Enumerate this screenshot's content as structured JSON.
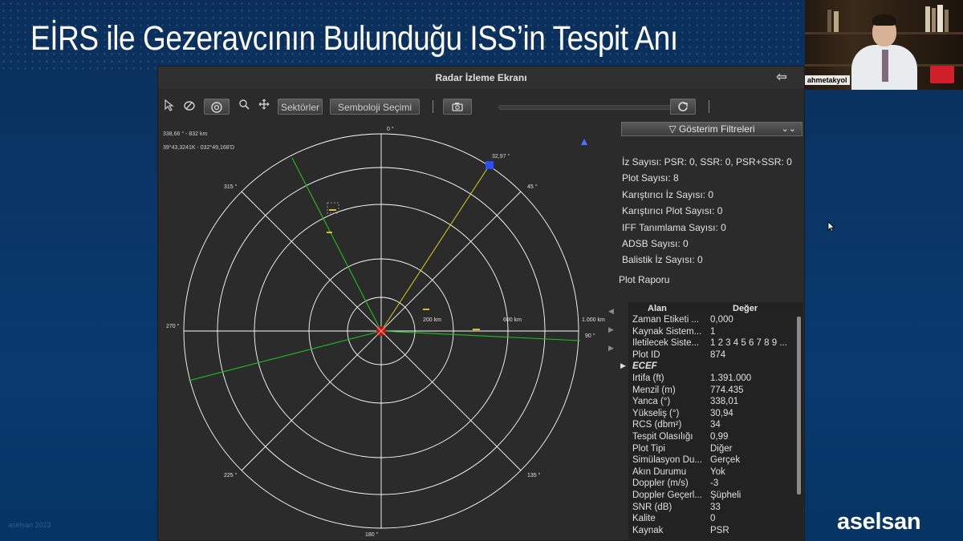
{
  "slide": {
    "title": "EİRS ile Gezeravcının Bulunduğu ISS’in Tespit Anı",
    "brand_logo": "aselsan",
    "watermark": "aselsan 2023"
  },
  "app": {
    "window_title": "Radar İzleme Ekranı",
    "toolbar": {
      "sectors_label": "Sektörler",
      "symbology_label": "Semboloji Seçimi"
    },
    "cursor_range": "338,66 ° - 832 km",
    "cursor_position": "39°43,3241K - 032°49,168'D"
  },
  "radar": {
    "bearing_labels": {
      "n": "0 °",
      "ne": "45 °",
      "e": "90 °",
      "se": "135 °",
      "s": "180 °",
      "sw": "225 °",
      "w": "270 °",
      "nw": "315 °"
    },
    "range_labels": {
      "r200": "200 km",
      "r600": "600 km",
      "r1000": "1.000 km"
    },
    "target_label": "32,97 °",
    "colors": {
      "background": "#2b2b2b",
      "rings": "#ffffff",
      "beam_green": "#20c020",
      "beam_yellow": "#d8d020",
      "target": "#2b4cff",
      "center": "#d01818"
    }
  },
  "filters": {
    "title": "Gösterim Filtreleri",
    "stats": [
      "İz Sayısı: PSR: 0, SSR: 0, PSR+SSR: 0",
      "Plot Sayısı: 8",
      "Karıştırıcı İz Sayısı: 0",
      "Karıştırıcı Plot Sayısı: 0",
      "IFF Tanımlama Sayısı: 0",
      "ADSB Sayısı: 0",
      "Balistik İz Sayısı: 0"
    ]
  },
  "plot_report": {
    "title": "Plot Raporu",
    "col_field": "Alan",
    "col_value": "Değer",
    "rows": [
      {
        "key": "Zaman Etiketi ...",
        "value": "0,000"
      },
      {
        "key": "Kaynak Sistem...",
        "value": "1"
      },
      {
        "key": "İletilecek Siste...",
        "value": "1 2 3 4 5 6 7 8 9 ..."
      },
      {
        "key": "Plot ID",
        "value": "874"
      },
      {
        "key": "ECEF",
        "value": ""
      },
      {
        "key": "İrtifa (ft)",
        "value": "1.391.000"
      },
      {
        "key": "Menzil (m)",
        "value": "774.435"
      },
      {
        "key": "Yanca (°)",
        "value": "338,01"
      },
      {
        "key": "Yükseliş (°)",
        "value": "30,94"
      },
      {
        "key": "RCS (dbm²)",
        "value": "34"
      },
      {
        "key": "Tespit Olasılığı",
        "value": "0,99"
      },
      {
        "key": "Plot Tipi",
        "value": "Diğer"
      },
      {
        "key": "Simülasyon Du...",
        "value": "Gerçek"
      },
      {
        "key": "Akın Durumu",
        "value": "Yok"
      },
      {
        "key": "Doppler (m/s)",
        "value": "-3"
      },
      {
        "key": "Doppler Geçerl...",
        "value": "Şüpheli"
      },
      {
        "key": "SNR (dB)",
        "value": "33"
      },
      {
        "key": "Kalite",
        "value": "0"
      },
      {
        "key": "Kaynak",
        "value": "PSR"
      }
    ]
  },
  "webcam": {
    "participant_name": "ahmetakyol"
  }
}
